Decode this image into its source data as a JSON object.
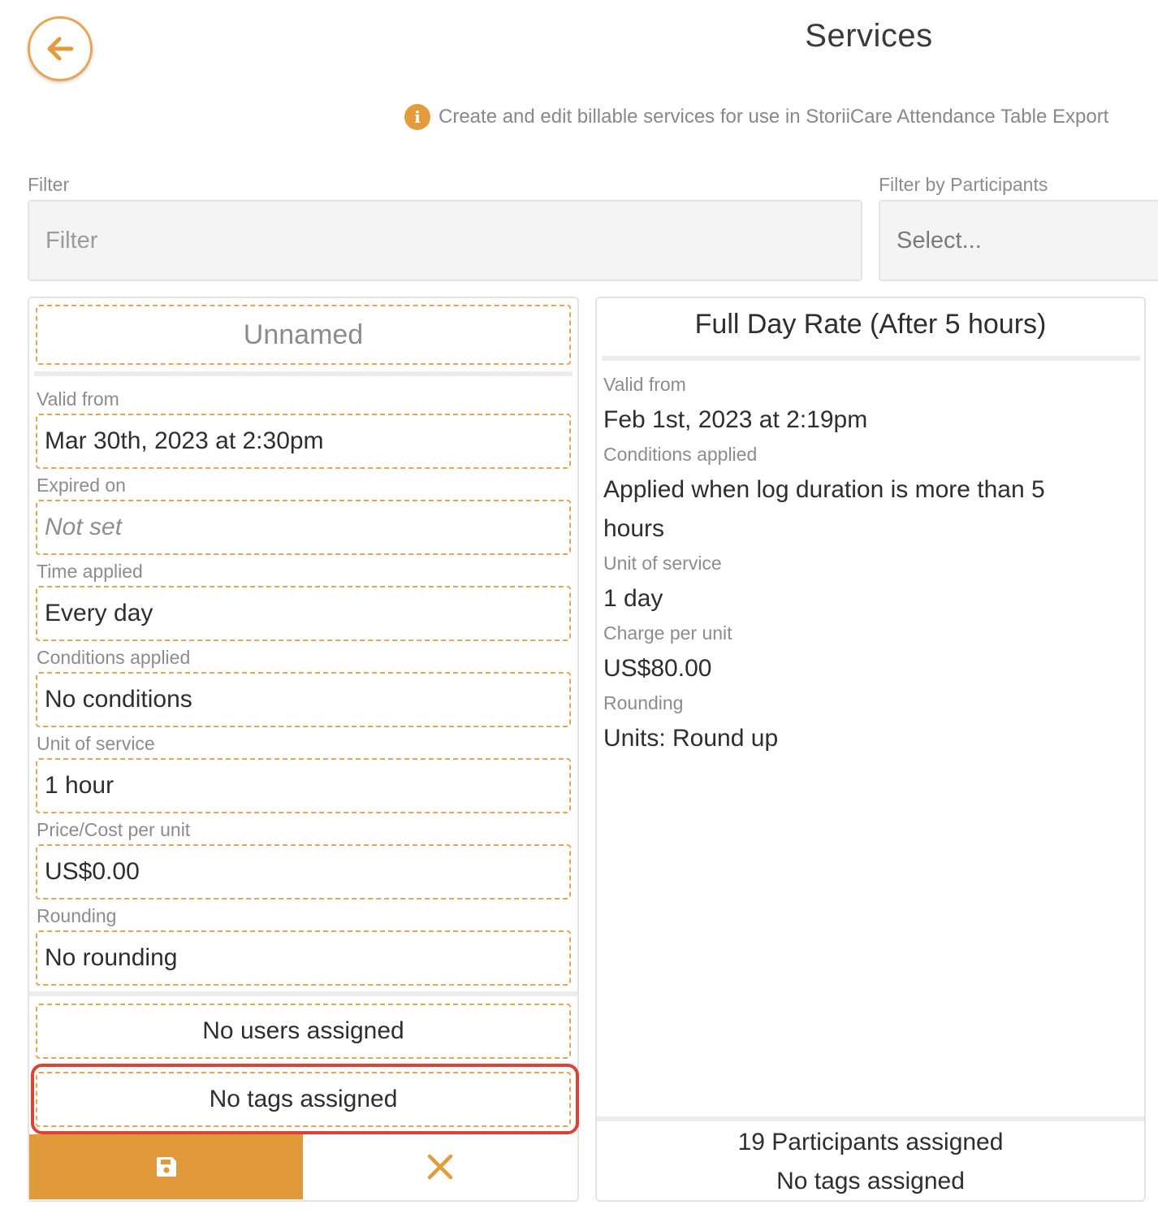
{
  "header": {
    "back_icon": "arrow-left-icon",
    "title": "Services",
    "info_icon": "info-icon",
    "info_text": "Create and edit billable services for use in StoriiCare Attendance Table Export"
  },
  "filters": {
    "filter_label": "Filter",
    "filter_placeholder": "Filter",
    "participants_label": "Filter by Participants",
    "participants_placeholder": "Select..."
  },
  "edit_card": {
    "name_placeholder": "Unnamed",
    "valid_from_label": "Valid from",
    "valid_from_value": "Mar 30th, 2023 at 2:30pm",
    "expired_on_label": "Expired on",
    "expired_on_value": "Not set",
    "time_applied_label": "Time applied",
    "time_applied_value": "Every day",
    "conditions_label": "Conditions applied",
    "conditions_value": "No conditions",
    "unit_label": "Unit of service",
    "unit_value": "1 hour",
    "price_label": "Price/Cost per unit",
    "price_value": "US$0.00",
    "rounding_label": "Rounding",
    "rounding_value": "No rounding",
    "users_value": "No users assigned",
    "tags_value": "No tags assigned",
    "save_icon": "save-icon",
    "cancel_icon": "close-icon"
  },
  "service_card": {
    "title": "Full Day Rate (After 5 hours)",
    "valid_from_label": "Valid from",
    "valid_from_value": "Feb 1st, 2023 at 2:19pm",
    "conditions_label": "Conditions applied",
    "conditions_value_line1": "Applied when log duration is more than 5",
    "conditions_value_line2": "hours",
    "unit_label": "Unit of service",
    "unit_value": "1 day",
    "charge_label": "Charge per unit",
    "charge_value": "US$80.00",
    "rounding_label": "Rounding",
    "rounding_value": "Units: Round up",
    "participants_assigned": "19 Participants assigned",
    "tags_assigned": "No tags assigned"
  },
  "colors": {
    "accent": "#e09a3c",
    "dashed_border": "#e8a44e",
    "highlight": "#dd4330"
  }
}
